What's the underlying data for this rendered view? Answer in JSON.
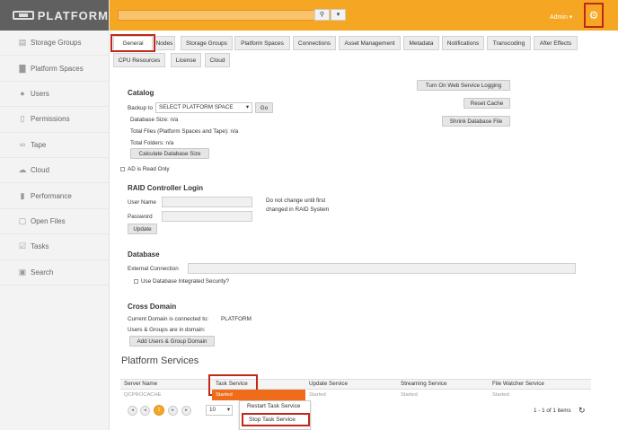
{
  "app": {
    "brand": "PLATFORM"
  },
  "sidebar": {
    "items": [
      {
        "label": "Storage Groups",
        "icon": "storage-icon"
      },
      {
        "label": "Platform Spaces",
        "icon": "folder-icon"
      },
      {
        "label": "Users",
        "icon": "users-icon"
      },
      {
        "label": "Permissions",
        "icon": "lock-icon"
      },
      {
        "label": "Tape",
        "icon": "tape-icon"
      },
      {
        "label": "Cloud",
        "icon": "cloud-icon"
      },
      {
        "label": "Performance",
        "icon": "performance-icon"
      },
      {
        "label": "Open Files",
        "icon": "file-icon"
      },
      {
        "label": "Tasks",
        "icon": "tasks-icon"
      },
      {
        "label": "Search",
        "icon": "search-icon"
      }
    ]
  },
  "topbar": {
    "user": "Admin ▾",
    "search_value": ""
  },
  "tabs": {
    "row1": [
      "General",
      "Nodes",
      "Storage Groups",
      "Platform Spaces",
      "Connections",
      "Asset Management",
      "Metadata",
      "Notifications",
      "Transcoding",
      "After Effects"
    ],
    "row2": [
      "CPU Resources",
      "License",
      "Cloud"
    ]
  },
  "catalog": {
    "title": "Catalog",
    "backup_label": "Backup to",
    "backup_select": "SELECT PLATFORM SPACE",
    "go": "Go",
    "db_size": "Database Size: n/a",
    "total_files": "Total Files (Platform Spaces and Tape): n/a",
    "total_folders": "Total Folders: n/a",
    "calc_btn": "Calculate Database Size",
    "ad_readonly": "AD is Read Only",
    "web_logging": "Turn On Web Service Logging",
    "reset_cache": "Reset Cache",
    "shrink_db": "Shrink Database File"
  },
  "raid": {
    "title": "RAID Controller Login",
    "user_label": "User Name",
    "pass_label": "Password",
    "note": "Do not change until first",
    "note2": "changed in RAID System",
    "update": "Update"
  },
  "database": {
    "title": "Database",
    "ext_label": "External Connection",
    "integrated": "Use Database Integrated Security?"
  },
  "cross": {
    "title": "Cross Domain",
    "connected_label": "Current Domain is connected to:",
    "connected_value": "PLATFORM",
    "in_domain": "Users & Groups are in domain:",
    "add_btn": "Add Users & Group Domain"
  },
  "services": {
    "title": "Platform Services",
    "headers": [
      "Server Name",
      "Task Service",
      "Update Service",
      "Streaming Service",
      "File Watcher Service"
    ],
    "row": [
      "QCPROCACHE",
      "Started",
      "Started",
      "Started",
      "Started"
    ],
    "page": "1",
    "page_size": "10",
    "items_info": "1 - 1 of 1 items",
    "menu": [
      "Restart Task Service",
      "Stop Task Service"
    ]
  },
  "colors": {
    "topbar": "#f5a623",
    "highlight": "#c0281a",
    "selected_cell": "#ef6c1a"
  }
}
